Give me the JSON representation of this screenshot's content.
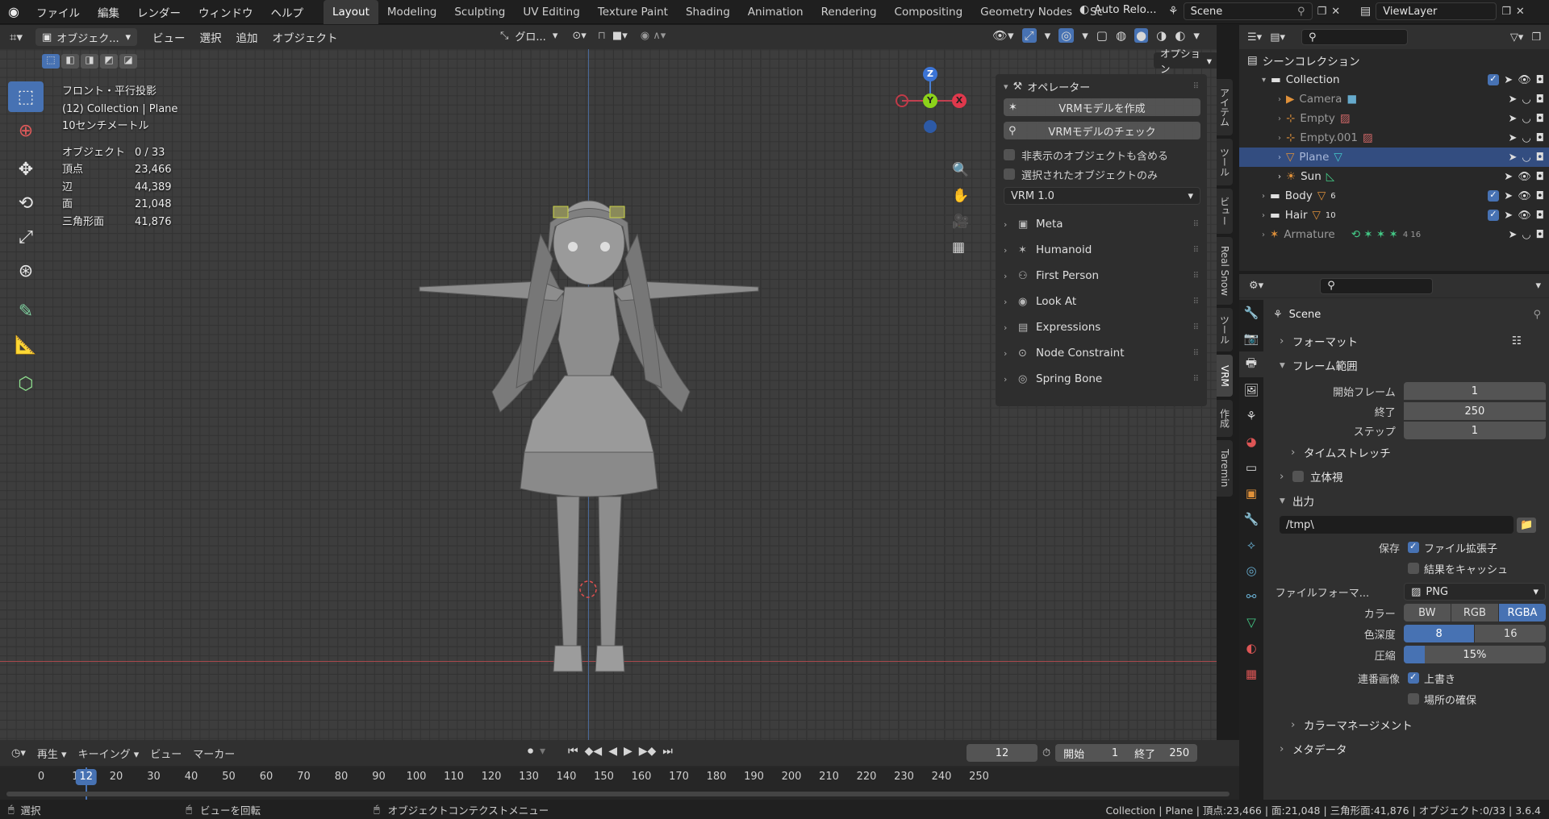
{
  "topbar": {
    "menus": [
      "ファイル",
      "編集",
      "レンダー",
      "ウィンドウ",
      "ヘルプ"
    ],
    "workspaces": [
      "Layout",
      "Modeling",
      "Sculpting",
      "UV Editing",
      "Texture Paint",
      "Shading",
      "Animation",
      "Rendering",
      "Compositing",
      "Geometry Nodes",
      "Sc"
    ],
    "active_workspace": "Layout",
    "auto_reload": "Auto Relo...",
    "scene": "Scene",
    "view_layer": "ViewLayer"
  },
  "viewport_header": {
    "mode": "オブジェク...",
    "menus": [
      "ビュー",
      "選択",
      "追加",
      "オブジェクト"
    ],
    "transform": "グロ...",
    "options": "オプション"
  },
  "overlay_stats": {
    "view": "フロント・平行投影",
    "collection": "(12) Collection | Plane",
    "scale": "10センチメートル",
    "rows": [
      {
        "label": "オブジェクト",
        "value": "0 / 33"
      },
      {
        "label": "頂点",
        "value": "23,466"
      },
      {
        "label": "辺",
        "value": "44,389"
      },
      {
        "label": "面",
        "value": "21,048"
      },
      {
        "label": "三角形面",
        "value": "41,876"
      }
    ]
  },
  "gizmo": {
    "z": "Z",
    "y": "Y",
    "x": "X"
  },
  "npanel": {
    "header": "オペレーター",
    "btn_create": "VRMモデルを作成",
    "btn_check": "VRMモデルのチェック",
    "chk_hidden": "非表示のオブジェクトも含める",
    "chk_selected": "選択されたオブジェクトのみ",
    "version": "VRM 1.0",
    "subpanels": [
      "Meta",
      "Humanoid",
      "First Person",
      "Look At",
      "Expressions",
      "Node Constraint",
      "Spring Bone"
    ]
  },
  "side_tabs": [
    "アイテム",
    "ツール",
    "ビュー",
    "Real Snow",
    "ツール",
    "VRM",
    "作成",
    "Taremin"
  ],
  "outliner": {
    "root": "シーンコレクション",
    "items": [
      {
        "name": "Collection",
        "level": 0
      },
      {
        "name": "Camera",
        "level": 1
      },
      {
        "name": "Empty",
        "level": 1
      },
      {
        "name": "Empty.001",
        "level": 1
      },
      {
        "name": "Plane",
        "level": 1
      },
      {
        "name": "Sun",
        "level": 1
      },
      {
        "name": "Body",
        "level": 0,
        "count": "6"
      },
      {
        "name": "Hair",
        "level": 0,
        "count": "10"
      },
      {
        "name": "Armature",
        "level": 0,
        "count": "4  16"
      }
    ]
  },
  "properties": {
    "title": "Scene",
    "format": "フォーマット",
    "frame_range": "フレーム範囲",
    "start_label": "開始フレーム",
    "start": "1",
    "end_label": "終了",
    "end": "250",
    "step_label": "ステップ",
    "step": "1",
    "time_stretch": "タイムストレッチ",
    "stereo": "立体視",
    "output": "出力",
    "path": "/tmp\\",
    "save_label": "保存",
    "file_ext": "ファイル拡張子",
    "cache": "結果をキャッシュ",
    "fmt_label": "ファイルフォーマ...",
    "fmt": "PNG",
    "color_label": "カラー",
    "color_opts": [
      "BW",
      "RGB",
      "RGBA"
    ],
    "depth_label": "色深度",
    "depth_opts": [
      "8",
      "16"
    ],
    "compress_label": "圧縮",
    "compress": "15%",
    "compress_fraction": 0.15,
    "seq_label": "連番画像",
    "overwrite": "上書き",
    "placeholders": "場所の確保",
    "color_mgmt": "カラーマネージメント",
    "metadata": "メタデータ"
  },
  "timeline": {
    "menus": [
      "再生",
      "キーイング",
      "ビュー",
      "マーカー"
    ],
    "current": "12",
    "start_label": "開始",
    "start": "1",
    "end_label": "終了",
    "end": "250",
    "ticks": [
      "0",
      "10",
      "20",
      "30",
      "40",
      "50",
      "60",
      "70",
      "80",
      "90",
      "100",
      "110",
      "120",
      "130",
      "140",
      "150",
      "160",
      "170",
      "180",
      "190",
      "200",
      "210",
      "220",
      "230",
      "240",
      "250"
    ]
  },
  "status": {
    "select": "選択",
    "rotate": "ビューを回転",
    "context": "オブジェクトコンテクストメニュー",
    "info": "Collection | Plane | 頂点:23,466 | 面:21,048 | 三角形面:41,876 | オブジェクト:0/33 | 3.6.4"
  }
}
